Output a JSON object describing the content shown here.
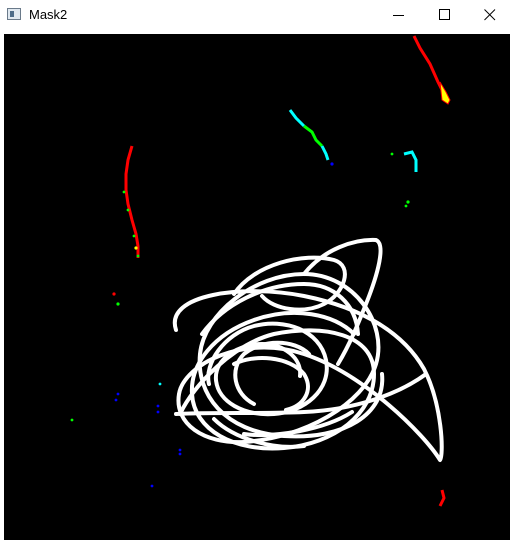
{
  "window": {
    "title": "Mask2",
    "app_icon": "opencv-window-icon",
    "controls": {
      "minimize": "minimize-icon",
      "maximize": "maximize-icon",
      "close": "close-icon"
    }
  },
  "mask": {
    "background": "#000000",
    "scribble_color": "#ffffff",
    "blob_colors": [
      "#ff0000",
      "#ffff00",
      "#00ffff",
      "#00ff00",
      "#0000ff"
    ]
  }
}
